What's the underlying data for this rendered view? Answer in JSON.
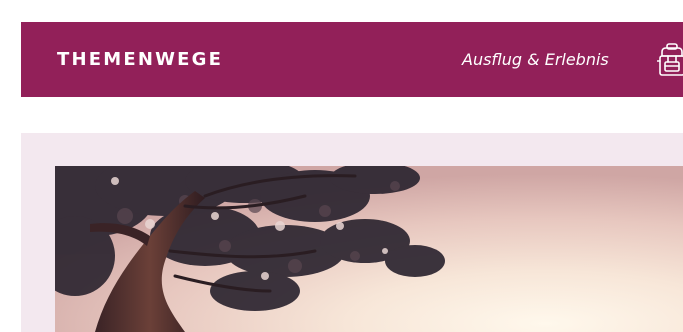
{
  "header": {
    "title": "THEMENWEGE",
    "category": "Ausflug & Erlebnis",
    "icon": "backpack-icon"
  },
  "hero": {
    "image": "pine-tree-sunset-photo"
  },
  "colors": {
    "header_bg": "#922059",
    "panel_bg": "#f3e8ef",
    "header_text": "#ffffff"
  }
}
